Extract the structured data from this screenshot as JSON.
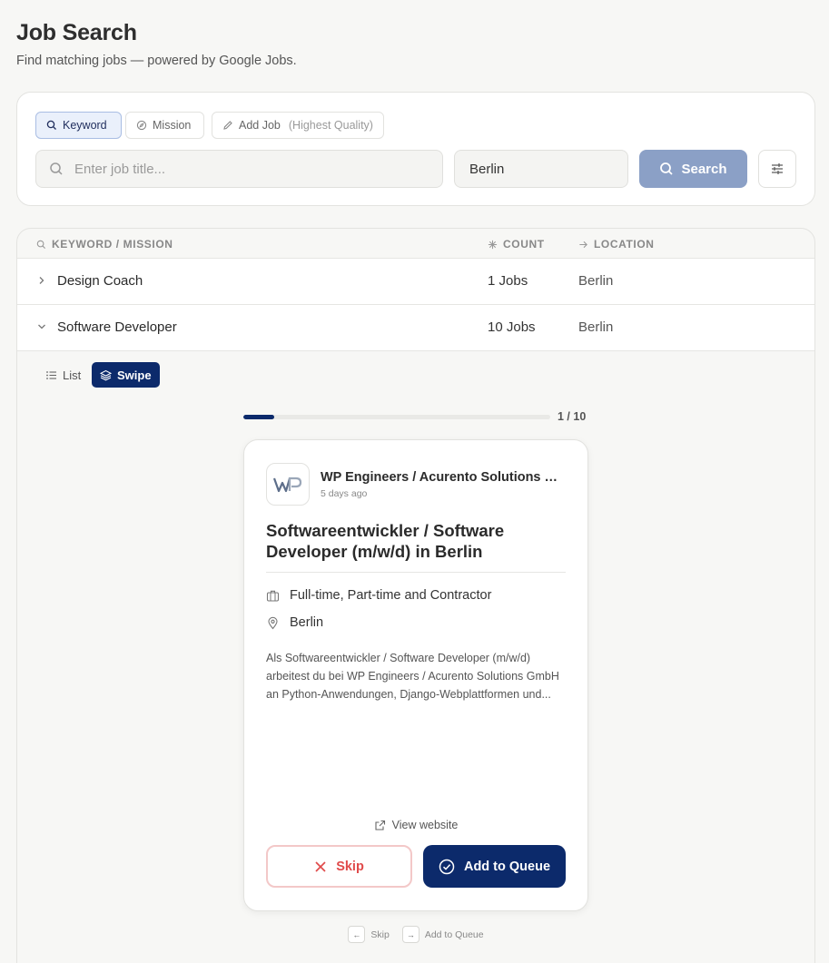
{
  "header": {
    "title": "Job Search",
    "subtitle": "Find matching jobs — powered by Google Jobs."
  },
  "search": {
    "tabs": [
      {
        "label": "Keyword",
        "icon": "search-icon",
        "active": true
      },
      {
        "label": "Mission",
        "icon": "compass-icon",
        "active": false
      },
      {
        "label": "Add Job",
        "hint": "(Highest Quality)",
        "icon": "pencil-icon",
        "active": false
      }
    ],
    "job_placeholder": "Enter job title...",
    "job_value": "",
    "location_value": "Berlin",
    "search_label": "Search"
  },
  "table": {
    "columns": [
      "KEYWORD / MISSION",
      "COUNT",
      "LOCATION"
    ],
    "rows": [
      {
        "keyword": "Design Coach",
        "count": "1 Jobs",
        "location": "Berlin",
        "expanded": false
      },
      {
        "keyword": "Software Developer",
        "count": "10 Jobs",
        "location": "Berlin",
        "expanded": true
      }
    ]
  },
  "view": {
    "list_label": "List",
    "swipe_label": "Swipe",
    "active": "swipe"
  },
  "swipe": {
    "progress_text": "1 / 10",
    "current": 1,
    "total": 10,
    "card": {
      "company": "WP Engineers / Acurento Solutions GmbH",
      "posted": "5 days ago",
      "title": "Softwareentwickler / Software Developer (m/w/d) in Berlin",
      "employment_type": "Full-time, Part-time and Contractor",
      "location": "Berlin",
      "description": "Als Softwareentwickler / Software Developer (m/w/d) arbeitest du bei WP Engineers / Acurento Solutions GmbH an Python-Anwendungen, Django-Webplattformen und...",
      "view_website_label": "View website",
      "skip_label": "Skip",
      "queue_label": "Add to Queue"
    },
    "shortcuts": [
      {
        "key": "←",
        "label": "Skip"
      },
      {
        "key": "→",
        "label": "Add to Queue"
      }
    ]
  },
  "colors": {
    "primary": "#0c2a6b",
    "search_button": "#8ba0c6",
    "skip_red": "#e04a4a"
  }
}
